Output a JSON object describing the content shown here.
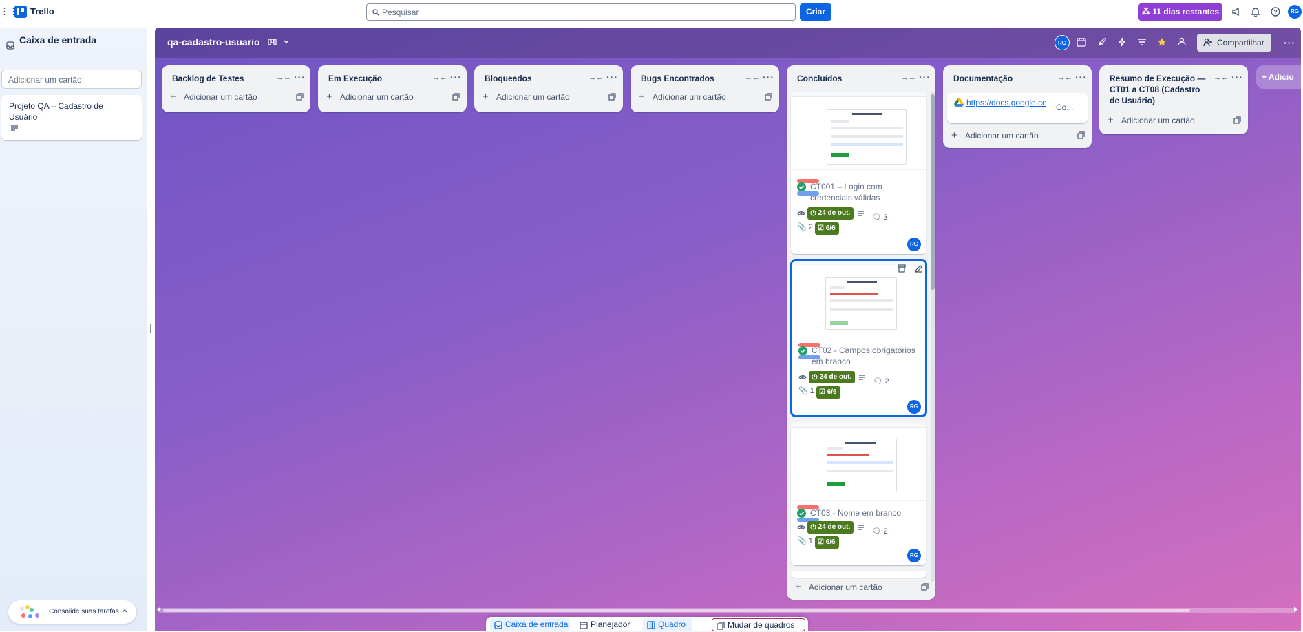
{
  "topbar": {
    "app_name": "Trello",
    "search_placeholder": "Pesquisar",
    "create_label": "Criar",
    "trial_label": "11 dias restantes",
    "avatar_initials": "RG",
    "icons": [
      "apps-icon",
      "trello-logo-icon",
      "search-icon",
      "megaphone-icon",
      "bell-icon",
      "help-icon"
    ],
    "accent_color": "#0c66e4",
    "trial_color": "#8f3fd4"
  },
  "inbox": {
    "title": "Caixa de entrada",
    "add_card_placeholder": "Adicionar um cartão",
    "cards": [
      {
        "title": "Projeto QA – Cadastro de Usuário",
        "has_description": true
      }
    ],
    "consolidate_label": "Consolide suas tarefas"
  },
  "board": {
    "title": "qa-cadastro-usuario",
    "share_label": "Compartilhar",
    "avatar_initials": "RG",
    "add_list_label": "Adicio",
    "header_icons": [
      "board-view-icon",
      "chevron-down-icon",
      "calendar-icon",
      "rocket-icon",
      "lightning-icon",
      "filter-icon",
      "star-icon",
      "people-icon",
      "share-icon",
      "more-icon"
    ]
  },
  "lists": [
    {
      "title": "Backlog de Testes",
      "add_card": "Adicionar um cartão"
    },
    {
      "title": "Em Execução",
      "add_card": "Adicionar um cartão"
    },
    {
      "title": "Bloqueados",
      "add_card": "Adicionar um cartão"
    },
    {
      "title": "Bugs Encontrados",
      "add_card": "Adicionar um cartão"
    },
    {
      "title": "Concluídos",
      "add_card": "Adicionar um cartão",
      "cards": [
        {
          "title": "CT001 – Login com credenciais válidas",
          "due": "24 de out.",
          "comments": "3",
          "attachments": "2",
          "checklist": "6/6",
          "member": "RG",
          "labels": [
            "#f87168",
            "#6f9fef"
          ]
        },
        {
          "title": "CT02 - Campos obrigatórios em branco",
          "due": "24 de out.",
          "comments": "2",
          "attachments": "1",
          "checklist": "6/6",
          "member": "RG",
          "labels": [
            "#f87168",
            "#6f9fef"
          ]
        },
        {
          "title": "CT03 - Nome em branco",
          "due": "24 de out.",
          "comments": "2",
          "attachments": "1",
          "checklist": "6/6",
          "member": "RG",
          "labels": [
            "#f87168",
            "#6f9fef"
          ]
        }
      ]
    },
    {
      "title": "Documentação",
      "add_card": "Adicionar um cartão",
      "link": {
        "text": "https://docs.google.com/spreadsheets/d...",
        "suffix": "Co..."
      }
    },
    {
      "title": "Resumo de Execução — CT01 a CT08 (Cadastro de Usuário)",
      "add_card": "Adicionar um cartão"
    }
  ],
  "bottom_nav": {
    "inbox": "Caixa de entrada",
    "planner": "Planejador",
    "board": "Quadro",
    "switch": "Mudar de quadros"
  }
}
